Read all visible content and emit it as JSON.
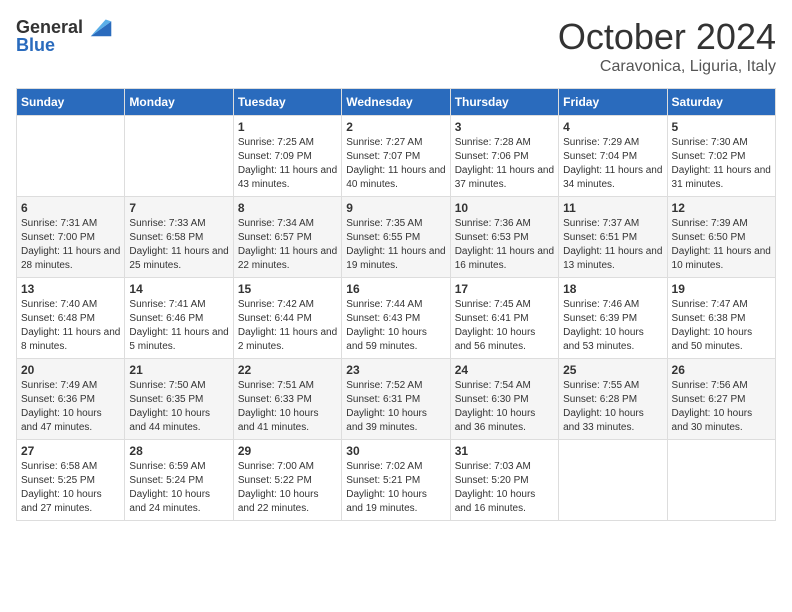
{
  "logo": {
    "general": "General",
    "blue": "Blue"
  },
  "title": "October 2024",
  "subtitle": "Caravonica, Liguria, Italy",
  "headers": [
    "Sunday",
    "Monday",
    "Tuesday",
    "Wednesday",
    "Thursday",
    "Friday",
    "Saturday"
  ],
  "weeks": [
    [
      {
        "day": "",
        "info": ""
      },
      {
        "day": "",
        "info": ""
      },
      {
        "day": "1",
        "info": "Sunrise: 7:25 AM\nSunset: 7:09 PM\nDaylight: 11 hours and 43 minutes."
      },
      {
        "day": "2",
        "info": "Sunrise: 7:27 AM\nSunset: 7:07 PM\nDaylight: 11 hours and 40 minutes."
      },
      {
        "day": "3",
        "info": "Sunrise: 7:28 AM\nSunset: 7:06 PM\nDaylight: 11 hours and 37 minutes."
      },
      {
        "day": "4",
        "info": "Sunrise: 7:29 AM\nSunset: 7:04 PM\nDaylight: 11 hours and 34 minutes."
      },
      {
        "day": "5",
        "info": "Sunrise: 7:30 AM\nSunset: 7:02 PM\nDaylight: 11 hours and 31 minutes."
      }
    ],
    [
      {
        "day": "6",
        "info": "Sunrise: 7:31 AM\nSunset: 7:00 PM\nDaylight: 11 hours and 28 minutes."
      },
      {
        "day": "7",
        "info": "Sunrise: 7:33 AM\nSunset: 6:58 PM\nDaylight: 11 hours and 25 minutes."
      },
      {
        "day": "8",
        "info": "Sunrise: 7:34 AM\nSunset: 6:57 PM\nDaylight: 11 hours and 22 minutes."
      },
      {
        "day": "9",
        "info": "Sunrise: 7:35 AM\nSunset: 6:55 PM\nDaylight: 11 hours and 19 minutes."
      },
      {
        "day": "10",
        "info": "Sunrise: 7:36 AM\nSunset: 6:53 PM\nDaylight: 11 hours and 16 minutes."
      },
      {
        "day": "11",
        "info": "Sunrise: 7:37 AM\nSunset: 6:51 PM\nDaylight: 11 hours and 13 minutes."
      },
      {
        "day": "12",
        "info": "Sunrise: 7:39 AM\nSunset: 6:50 PM\nDaylight: 11 hours and 10 minutes."
      }
    ],
    [
      {
        "day": "13",
        "info": "Sunrise: 7:40 AM\nSunset: 6:48 PM\nDaylight: 11 hours and 8 minutes."
      },
      {
        "day": "14",
        "info": "Sunrise: 7:41 AM\nSunset: 6:46 PM\nDaylight: 11 hours and 5 minutes."
      },
      {
        "day": "15",
        "info": "Sunrise: 7:42 AM\nSunset: 6:44 PM\nDaylight: 11 hours and 2 minutes."
      },
      {
        "day": "16",
        "info": "Sunrise: 7:44 AM\nSunset: 6:43 PM\nDaylight: 10 hours and 59 minutes."
      },
      {
        "day": "17",
        "info": "Sunrise: 7:45 AM\nSunset: 6:41 PM\nDaylight: 10 hours and 56 minutes."
      },
      {
        "day": "18",
        "info": "Sunrise: 7:46 AM\nSunset: 6:39 PM\nDaylight: 10 hours and 53 minutes."
      },
      {
        "day": "19",
        "info": "Sunrise: 7:47 AM\nSunset: 6:38 PM\nDaylight: 10 hours and 50 minutes."
      }
    ],
    [
      {
        "day": "20",
        "info": "Sunrise: 7:49 AM\nSunset: 6:36 PM\nDaylight: 10 hours and 47 minutes."
      },
      {
        "day": "21",
        "info": "Sunrise: 7:50 AM\nSunset: 6:35 PM\nDaylight: 10 hours and 44 minutes."
      },
      {
        "day": "22",
        "info": "Sunrise: 7:51 AM\nSunset: 6:33 PM\nDaylight: 10 hours and 41 minutes."
      },
      {
        "day": "23",
        "info": "Sunrise: 7:52 AM\nSunset: 6:31 PM\nDaylight: 10 hours and 39 minutes."
      },
      {
        "day": "24",
        "info": "Sunrise: 7:54 AM\nSunset: 6:30 PM\nDaylight: 10 hours and 36 minutes."
      },
      {
        "day": "25",
        "info": "Sunrise: 7:55 AM\nSunset: 6:28 PM\nDaylight: 10 hours and 33 minutes."
      },
      {
        "day": "26",
        "info": "Sunrise: 7:56 AM\nSunset: 6:27 PM\nDaylight: 10 hours and 30 minutes."
      }
    ],
    [
      {
        "day": "27",
        "info": "Sunrise: 6:58 AM\nSunset: 5:25 PM\nDaylight: 10 hours and 27 minutes."
      },
      {
        "day": "28",
        "info": "Sunrise: 6:59 AM\nSunset: 5:24 PM\nDaylight: 10 hours and 24 minutes."
      },
      {
        "day": "29",
        "info": "Sunrise: 7:00 AM\nSunset: 5:22 PM\nDaylight: 10 hours and 22 minutes."
      },
      {
        "day": "30",
        "info": "Sunrise: 7:02 AM\nSunset: 5:21 PM\nDaylight: 10 hours and 19 minutes."
      },
      {
        "day": "31",
        "info": "Sunrise: 7:03 AM\nSunset: 5:20 PM\nDaylight: 10 hours and 16 minutes."
      },
      {
        "day": "",
        "info": ""
      },
      {
        "day": "",
        "info": ""
      }
    ]
  ]
}
